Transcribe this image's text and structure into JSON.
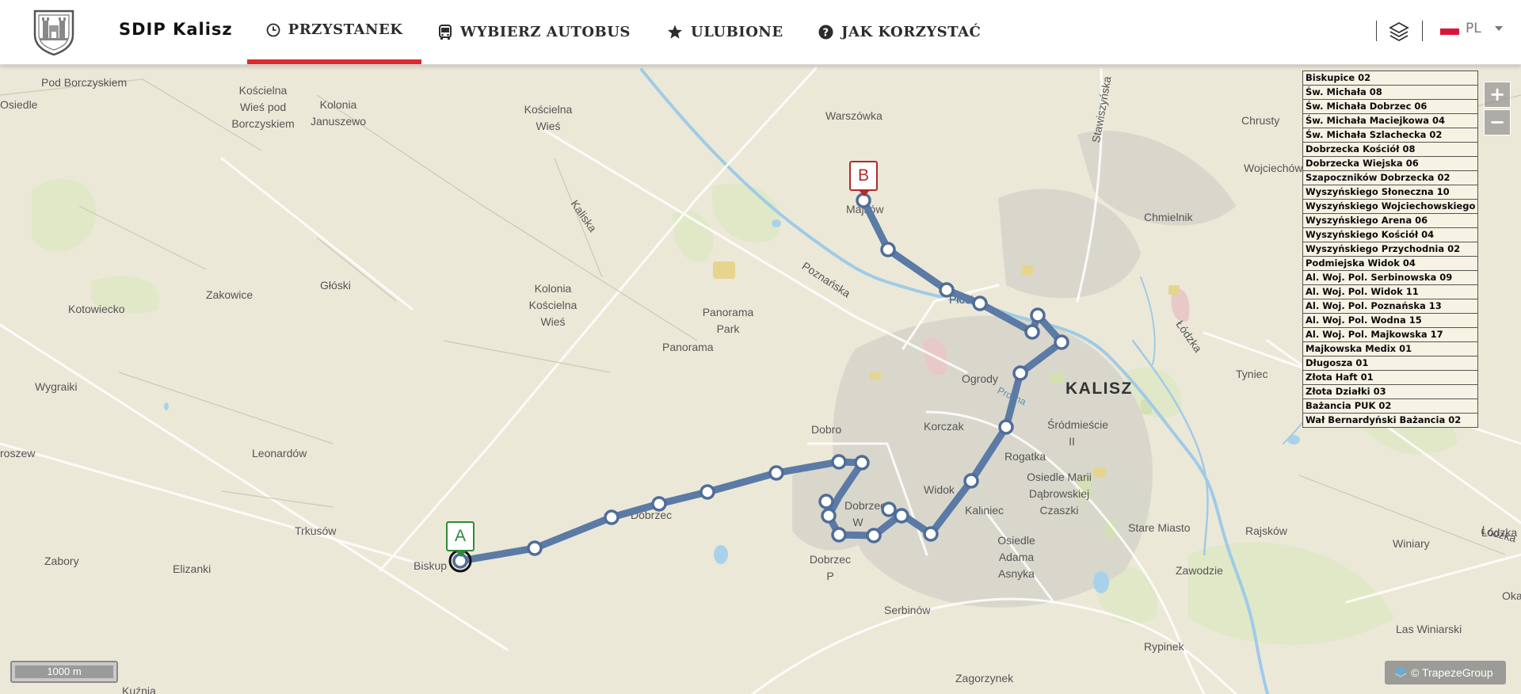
{
  "header": {
    "brand": "SDIP Kalisz",
    "nav": [
      {
        "label": "PRZYSTANEK",
        "icon": "clock-icon",
        "active": true
      },
      {
        "label": "WYBIERZ AUTOBUS",
        "icon": "bus-icon",
        "active": false
      },
      {
        "label": "ULUBIONE",
        "icon": "star-icon",
        "active": false
      },
      {
        "label": "JAK KORZYSTAĆ",
        "icon": "question-circle-icon",
        "active": false
      }
    ],
    "language": "PL",
    "active_tab_color": "#dd2a30"
  },
  "map": {
    "places": [
      "Pod Borczyskiem",
      "Kościelna Wieś pod Borczyskiem",
      "Kolonia Januszewo",
      "Kościelna Wieś",
      "Osiedle",
      "Warszówka",
      "Stawiszyńska",
      "Chrusty",
      "Wojciechów",
      "Majków",
      "Chmielnik",
      "Zakowice",
      "Głóski",
      "Kotowiecko",
      "Kolonia Kościelna Wieś",
      "Panorama Park",
      "Panorama",
      "Wygraiki",
      "Ogrody",
      "Dobro",
      "Korczak",
      "Śródmieście II",
      "Rogatka",
      "Osiedle Marii Dąbrowskiej Czaszki",
      "Widok",
      "Kaliniec",
      "Leonardów",
      "Trkusów",
      "Zabory",
      "Elizanki",
      "Biskup",
      "Dobrzec",
      "Dobrzec W",
      "Dobrzec P",
      "Stare Miasto",
      "Rajsków",
      "Tyniec",
      "Winiary",
      "Zawodzie",
      "Osiedle Adama Asnyka",
      "Serbinów",
      "Rypinek",
      "Zagorzynek",
      "Las Winiarski",
      "Kuźnia",
      "Płock",
      "roszew",
      "Łódzka",
      "Oka"
    ],
    "roads": [
      "Kaliska",
      "Poznańska",
      "Łódzka",
      "Łódzka"
    ],
    "city": "KALISZ",
    "river": "Prosna",
    "route_color": "#5b7aa6",
    "stop_list": [
      "Biskupice 02",
      "Św. Michała 08",
      "Św. Michała Dobrzec 06",
      "Św. Michała Maciejkowa 04",
      "Św. Michała Szlachecka 02",
      "Dobrzecka Kościół 08",
      "Dobrzecka Wiejska 06",
      "Szapoczników Dobrzecka 02",
      "Wyszyńskiego Słoneczna 10",
      "Wyszyńskiego Wojciechowskiego",
      "Wyszyńskiego Arena 06",
      "Wyszyńskiego Kościół 04",
      "Wyszyńskiego Przychodnia 02",
      "Podmiejska Widok 04",
      "Al. Woj. Pol. Serbinowska 09",
      "Al. Woj. Pol. Widok 11",
      "Al. Woj. Pol. Poznańska 13",
      "Al. Woj. Pol. Wodna 15",
      "Al. Woj. Pol. Majkowska 17",
      "Majkowska Medix 01",
      "Długosza 01",
      "Złota Haft 01",
      "Złota Działki 03",
      "Bażancia PUK 02",
      "Wał Bernardyński Bażancia 02"
    ],
    "markers": {
      "start": "A",
      "end": "B"
    },
    "zoom": {
      "in": "+",
      "out": "−"
    },
    "scale": "1000 m",
    "attribution": "© TrapezeGroup"
  }
}
